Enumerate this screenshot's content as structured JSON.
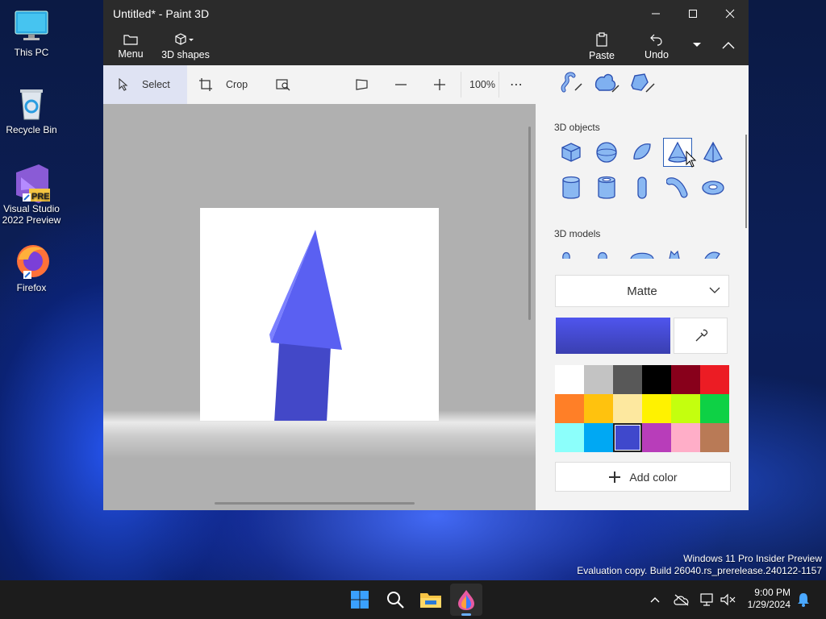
{
  "desktop": {
    "icons": [
      {
        "label": "This PC"
      },
      {
        "label": "Recycle Bin"
      },
      {
        "label": "Visual Studio 2022 Preview",
        "badge": "PRE"
      },
      {
        "label": "Firefox"
      }
    ]
  },
  "window": {
    "title": "Untitled* - Paint 3D",
    "ribbon": {
      "menu": "Menu",
      "shapes": "3D shapes",
      "paste": "Paste",
      "undo": "Undo"
    },
    "toolbar": {
      "select": "Select",
      "crop": "Crop",
      "zoom": "100%",
      "more": "⋯"
    },
    "panel": {
      "objects_label": "3D objects",
      "models_label": "3D models",
      "material": "Matte",
      "add_color": "Add color",
      "current_color": "#4f55ee",
      "palette": [
        "#ffffff",
        "#c3c3c3",
        "#585858",
        "#000000",
        "#88001b",
        "#ec1c24",
        "#ff7f27",
        "#ffc20e",
        "#fde89f",
        "#fff200",
        "#c4ff0e",
        "#0ed145",
        "#8cfffb",
        "#00a8f3",
        "#3f48cc",
        "#b83dba",
        "#ffaec8",
        "#b97a56"
      ],
      "selected_swatch": 14
    }
  },
  "watermark": {
    "line1": "Windows 11 Pro Insider Preview",
    "line2": "Evaluation copy. Build 26040.rs_prerelease.240122-1157"
  },
  "clock": {
    "time": "9:00 PM",
    "date": "1/29/2024"
  }
}
